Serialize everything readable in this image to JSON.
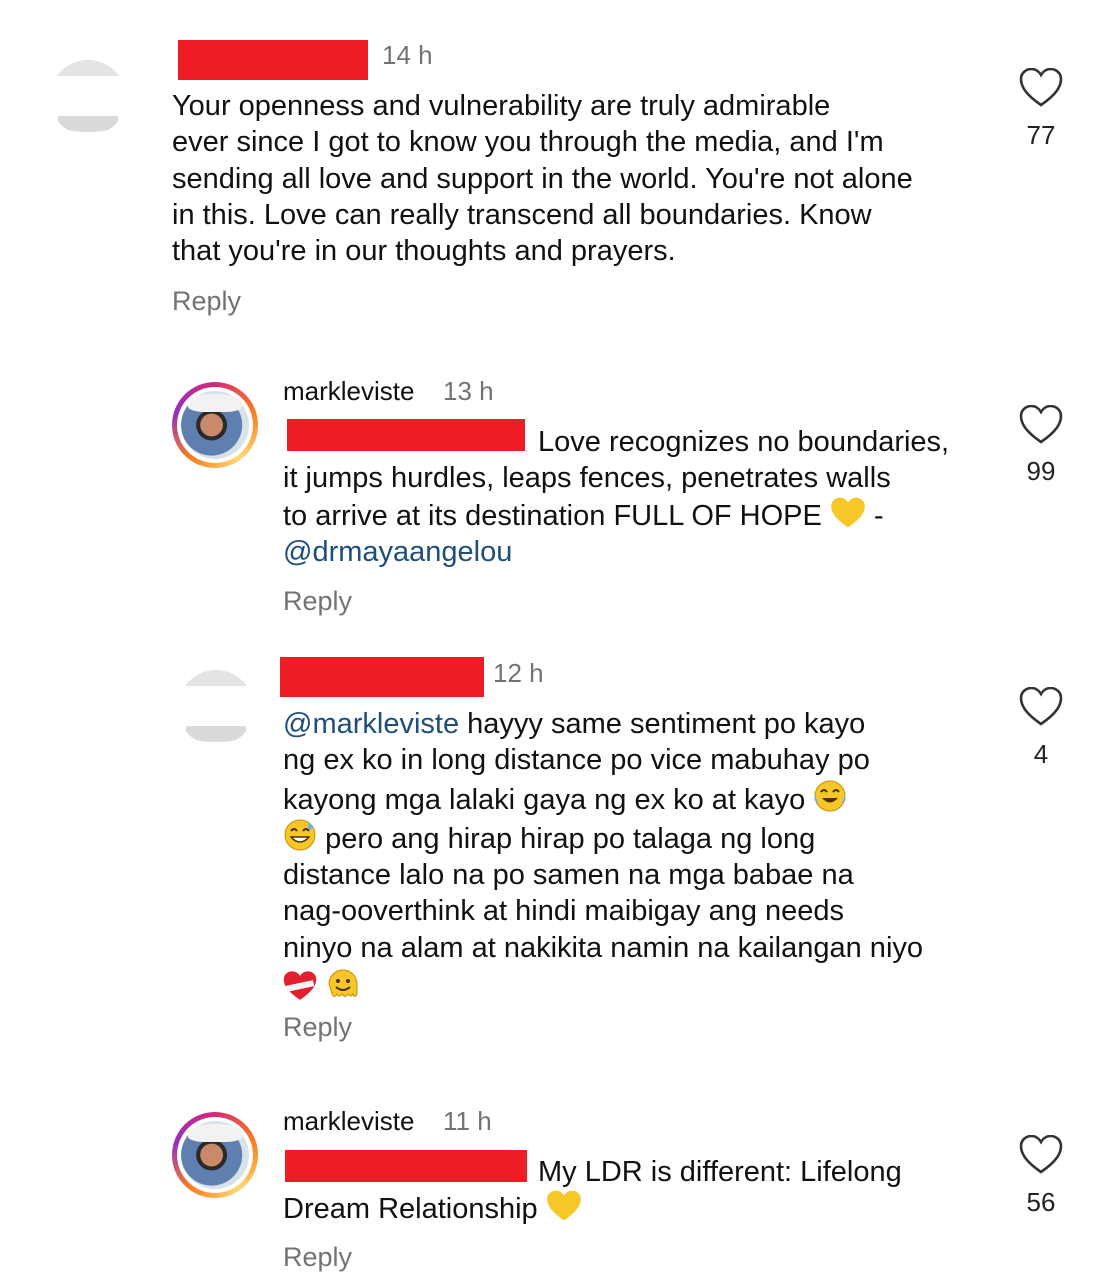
{
  "comments": [
    {
      "time": "14 h",
      "lines": [
        "Your openness and vulnerability are truly admirable",
        "ever since I got to know you through the media, and I'm",
        "sending all love and support in the world. You're not alone",
        "in this. Love can really transcend all boundaries. Know",
        "that you're in our thoughts and prayers."
      ],
      "reply": "Reply",
      "likes": "77"
    },
    {
      "username": "markleviste",
      "time": "13 h",
      "line1": "Love recognizes no boundaries,",
      "line2": "it jumps hurdles, leaps fences, penetrates walls",
      "line3": "to arrive at its destination FULL OF HOPE",
      "line3_end": "-",
      "mention": "@drmayaangelou",
      "reply": "Reply",
      "likes": "99"
    },
    {
      "time": "12 h",
      "mention": "@markleviste",
      "line1": "hayyy same sentiment po kayo",
      "line2": "ng ex ko in long distance po vice mabuhay po",
      "line3": "kayong mga lalaki gaya ng ex ko at kayo",
      "line4": "pero ang hirap hirap po talaga ng long",
      "line5": "distance lalo na po samen na mga babae na",
      "line6": "nag-ooverthink at hindi maibigay ang needs",
      "line7": "ninyo na alam at nakikita namin na kailangan niyo",
      "reply": "Reply",
      "likes": "4"
    },
    {
      "username": "markleviste",
      "time": "11 h",
      "line1": "My LDR is different: Lifelong",
      "line2": "Dream Relationship",
      "reply": "Reply",
      "likes": "56"
    }
  ],
  "icons": {
    "heart": "heart-outline-icon",
    "yellow_heart": "yellow-heart-emoji",
    "laughing": "tears-of-joy-emoji",
    "sweat_smile": "grinning-sweat-emoji",
    "mending_heart": "mending-heart-emoji",
    "melting": "melting-face-emoji"
  },
  "colors": {
    "redaction": "#ee1c24",
    "muted": "#737373",
    "mention": "#1f4e79",
    "emoji_yellow": "#f7c628"
  }
}
